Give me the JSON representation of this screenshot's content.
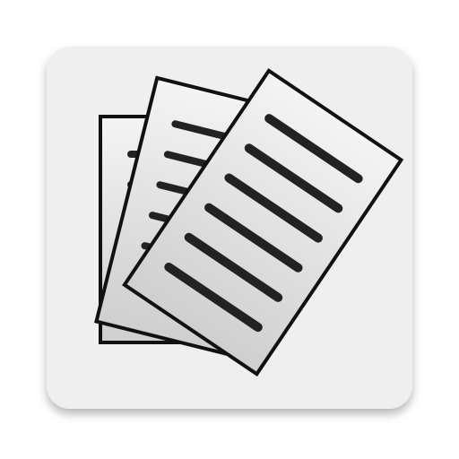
{
  "app_icon": {
    "icon": "document-stack-icon",
    "colors": {
      "tile": "#efefef",
      "page": "#e2e2e2",
      "outline": "#111111",
      "text_line": "#222222"
    }
  }
}
